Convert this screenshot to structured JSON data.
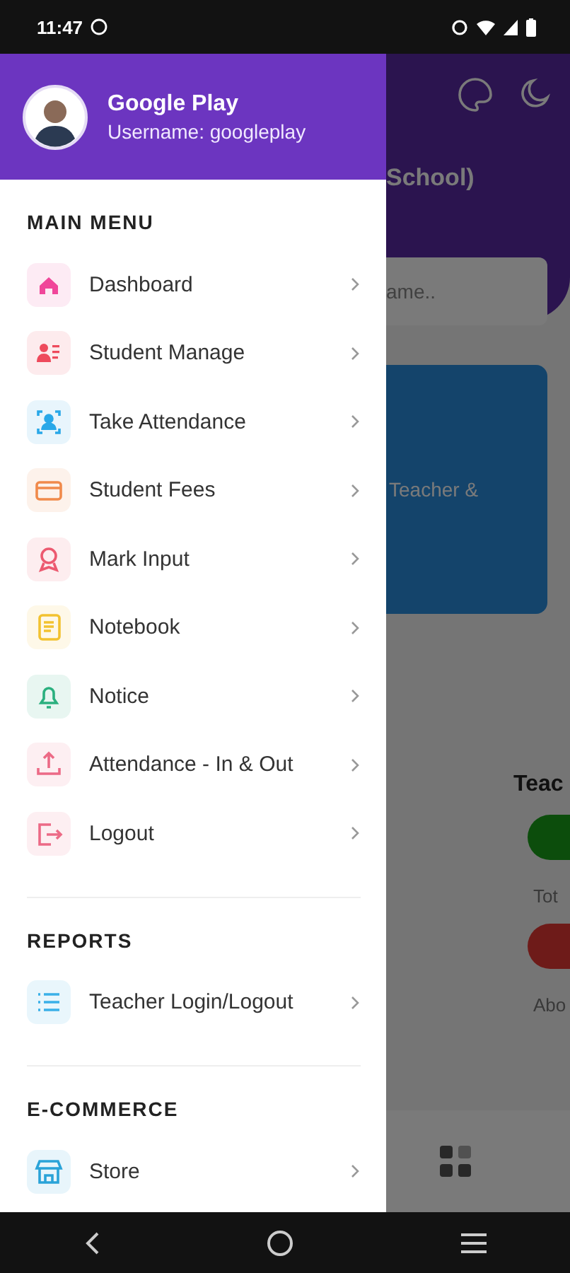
{
  "status_bar": {
    "time": "11:47"
  },
  "drawer": {
    "user": {
      "name": "Google Play",
      "username": "Username: googleplay"
    },
    "sections": [
      {
        "title": "MAIN MENU",
        "items": [
          {
            "label": "Dashboard",
            "kind": "home",
            "color": "#f0469a"
          },
          {
            "label": "Student Manage",
            "kind": "students",
            "color": "#ee4a5c"
          },
          {
            "label": "Take Attendance",
            "kind": "scan",
            "color": "#29a8e8"
          },
          {
            "label": "Student Fees",
            "kind": "card",
            "color": "#f08a4b"
          },
          {
            "label": "Mark Input",
            "kind": "award",
            "color": "#ec5a70"
          },
          {
            "label": "Notebook",
            "kind": "notebook",
            "color": "#f2c230"
          },
          {
            "label": "Notice",
            "kind": "bell",
            "color": "#2bb07f"
          },
          {
            "label": "Attendance - In & Out",
            "kind": "upload",
            "color": "#ec6a86"
          },
          {
            "label": "Logout",
            "kind": "logout",
            "color": "#ec6a86"
          }
        ]
      },
      {
        "title": "REPORTS",
        "items": [
          {
            "label": "Teacher Login/Logout",
            "kind": "list",
            "color": "#3ab0e8"
          }
        ]
      },
      {
        "title": "E-COMMERCE",
        "items": [
          {
            "label": "Store",
            "kind": "store",
            "color": "#2aa3d8"
          }
        ]
      }
    ]
  },
  "background": {
    "school": "School)",
    "search_placeholder": "ame..",
    "card_text": "Teacher &",
    "heading": "Teac",
    "total_label": "Tot",
    "absent_label": "Abo"
  }
}
